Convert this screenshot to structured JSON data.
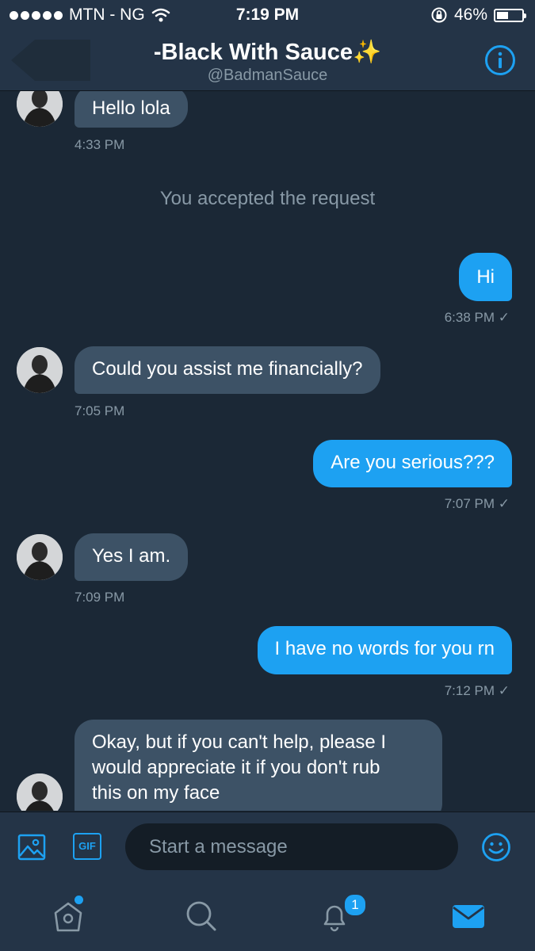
{
  "status_bar": {
    "carrier": "MTN - NG",
    "time": "7:19 PM",
    "battery": "46%",
    "battery_level": 0.46
  },
  "header": {
    "title": "-Black With Sauce✨",
    "handle": "@BadmanSauce",
    "back_icon": "back-arrow-icon",
    "info_icon": "info-icon"
  },
  "messages": {
    "m1": {
      "text": "Hello lola",
      "time": "4:33 PM"
    },
    "system": "You accepted the request",
    "m2": {
      "text": "Hi",
      "time": "6:38 PM ✓"
    },
    "m3": {
      "text": "Could you assist me financially?",
      "time": "7:05 PM"
    },
    "m4": {
      "text": "Are you serious???",
      "time": "7:07 PM ✓"
    },
    "m5": {
      "text": "Yes I am.",
      "time": "7:09 PM"
    },
    "m6": {
      "text": "I have no words for you rn",
      "time": "7:12 PM ✓"
    },
    "m7": {
      "lines": [
        "Okay, but if you can't help, please I",
        "would appreciate it if you don't rub",
        "this on my face"
      ]
    }
  },
  "composer": {
    "placeholder": "Start a message",
    "gif_label": "GIF"
  },
  "tabbar": {
    "notifications_badge": "1"
  },
  "colors": {
    "background": "#1b2836",
    "bar": "#243447",
    "accent": "#1da1f2",
    "incoming_bubble": "#3d5266",
    "muted_text": "#8899a6"
  }
}
